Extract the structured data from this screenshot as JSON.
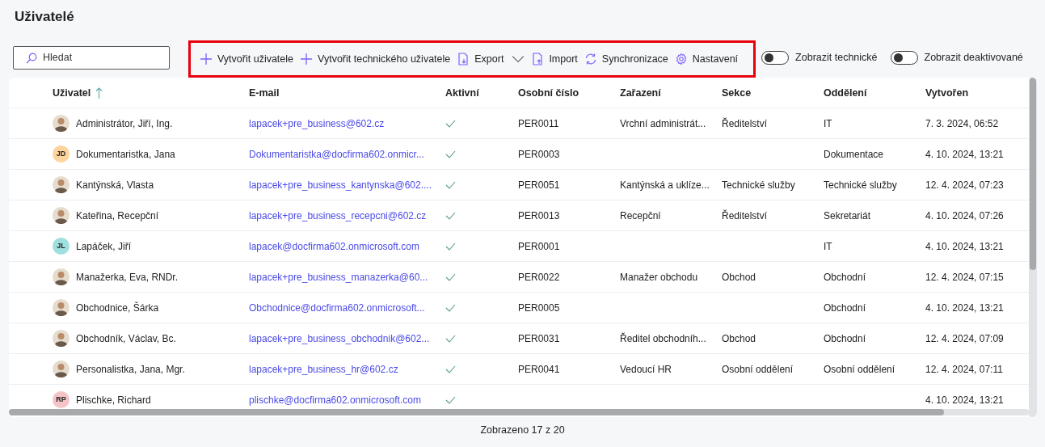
{
  "page": {
    "title": "Uživatelé"
  },
  "search": {
    "placeholder": "Hledat"
  },
  "toolbar": [
    {
      "label": "Vytvořit uživatele",
      "dropdown": false
    },
    {
      "label": "Vytvořit technického uživatele",
      "dropdown": false
    },
    {
      "label": "Export",
      "dropdown": true
    },
    {
      "label": "Import",
      "dropdown": false
    },
    {
      "label": "Synchronizace",
      "dropdown": false
    },
    {
      "label": "Nastavení",
      "dropdown": false
    }
  ],
  "toggles": [
    {
      "label": "Zobrazit technické",
      "on": false
    },
    {
      "label": "Zobrazit deaktivované",
      "on": false
    }
  ],
  "table": {
    "columns": [
      {
        "label": "Uživatel",
        "sorted": true
      },
      {
        "label": "E-mail",
        "sorted": false
      },
      {
        "label": "Aktivní",
        "sorted": false
      },
      {
        "label": "Osobní číslo",
        "sorted": false
      },
      {
        "label": "Zařazení",
        "sorted": false
      },
      {
        "label": "Sekce",
        "sorted": false
      },
      {
        "label": "Oddělení",
        "sorted": false
      },
      {
        "label": "Vytvořen",
        "sorted": false
      }
    ],
    "rows": [
      {
        "avatar": {
          "kind": "photo"
        },
        "name": "Administrátor, Jiří, Ing.",
        "email": "lapacek+pre_business@602.cz",
        "active": true,
        "number": "PER0011",
        "position": "Vrchní administrát...",
        "section": "Ředitelství",
        "department": "IT",
        "created": "7. 3. 2024, 06:52"
      },
      {
        "avatar": {
          "kind": "initials",
          "initials": "JD",
          "color": "#fcd49c"
        },
        "name": "Dokumentaristka, Jana",
        "email": "Dokumentaristka@docfirma602.onmicr...",
        "active": true,
        "number": "PER0003",
        "department": "Dokumentace",
        "created": "4. 10. 2024, 13:21"
      },
      {
        "avatar": {
          "kind": "photo"
        },
        "name": "Kantýnská, Vlasta",
        "email": "lapacek+pre_business_kantynska@602....",
        "active": true,
        "number": "PER0051",
        "position": "Kantýnská a uklíze...",
        "section": "Technické služby",
        "department": "Technické služby",
        "created": "12. 4. 2024, 07:23"
      },
      {
        "avatar": {
          "kind": "photo"
        },
        "name": "Kateřina, Recepční",
        "email": "lapacek+pre_business_recepcni@602.cz",
        "active": true,
        "number": "PER0013",
        "position": "Recepční",
        "section": "Ředitelství",
        "department": "Sekretariát",
        "created": "4. 10. 2024, 07:26"
      },
      {
        "avatar": {
          "kind": "initials",
          "initials": "JL",
          "color": "#9fdfe0"
        },
        "name": "Lapáček, Jiří",
        "email": "lapacek@docfirma602.onmicrosoft.com",
        "active": true,
        "number": "PER0001",
        "department": "IT",
        "created": "4. 10. 2024, 13:21"
      },
      {
        "avatar": {
          "kind": "photo"
        },
        "name": "Manažerka, Eva, RNDr.",
        "email": "lapacek+pre_business_manazerka@60...",
        "active": true,
        "number": "PER0022",
        "position": "Manažer obchodu",
        "section": "Obchod",
        "department": "Obchodní",
        "created": "12. 4. 2024, 07:15"
      },
      {
        "avatar": {
          "kind": "photo"
        },
        "name": "Obchodnice, Šárka",
        "email": "Obchodnice@docfirma602.onmicrosoft...",
        "active": true,
        "number": "PER0005",
        "department": "Obchodní",
        "created": "4. 10. 2024, 13:21"
      },
      {
        "avatar": {
          "kind": "photo"
        },
        "name": "Obchodník, Václav, Bc.",
        "email": "lapacek+pre_business_obchodnik@602...",
        "active": true,
        "number": "PER0031",
        "position": "Ředitel obchodníh...",
        "section": "Obchod",
        "department": "Obchodní",
        "created": "12. 4. 2024, 07:09"
      },
      {
        "avatar": {
          "kind": "photo"
        },
        "name": "Personalistka, Jana, Mgr.",
        "email": "lapacek+pre_business_hr@602.cz",
        "active": true,
        "number": "PER0041",
        "position": "Vedoucí HR",
        "section": "Osobní oddělení",
        "department": "Osobní oddělení",
        "created": "12. 4. 2024, 07:11"
      },
      {
        "avatar": {
          "kind": "initials",
          "initials": "RP",
          "color": "#f4c4c8"
        },
        "name": "Plischke, Richard",
        "email": "plischke@docfirma602.onmicrosoft.com",
        "active": true,
        "created": "4. 10. 2024, 13:21"
      }
    ]
  },
  "footer": {
    "status": "Zobrazeno 17 z 20"
  }
}
